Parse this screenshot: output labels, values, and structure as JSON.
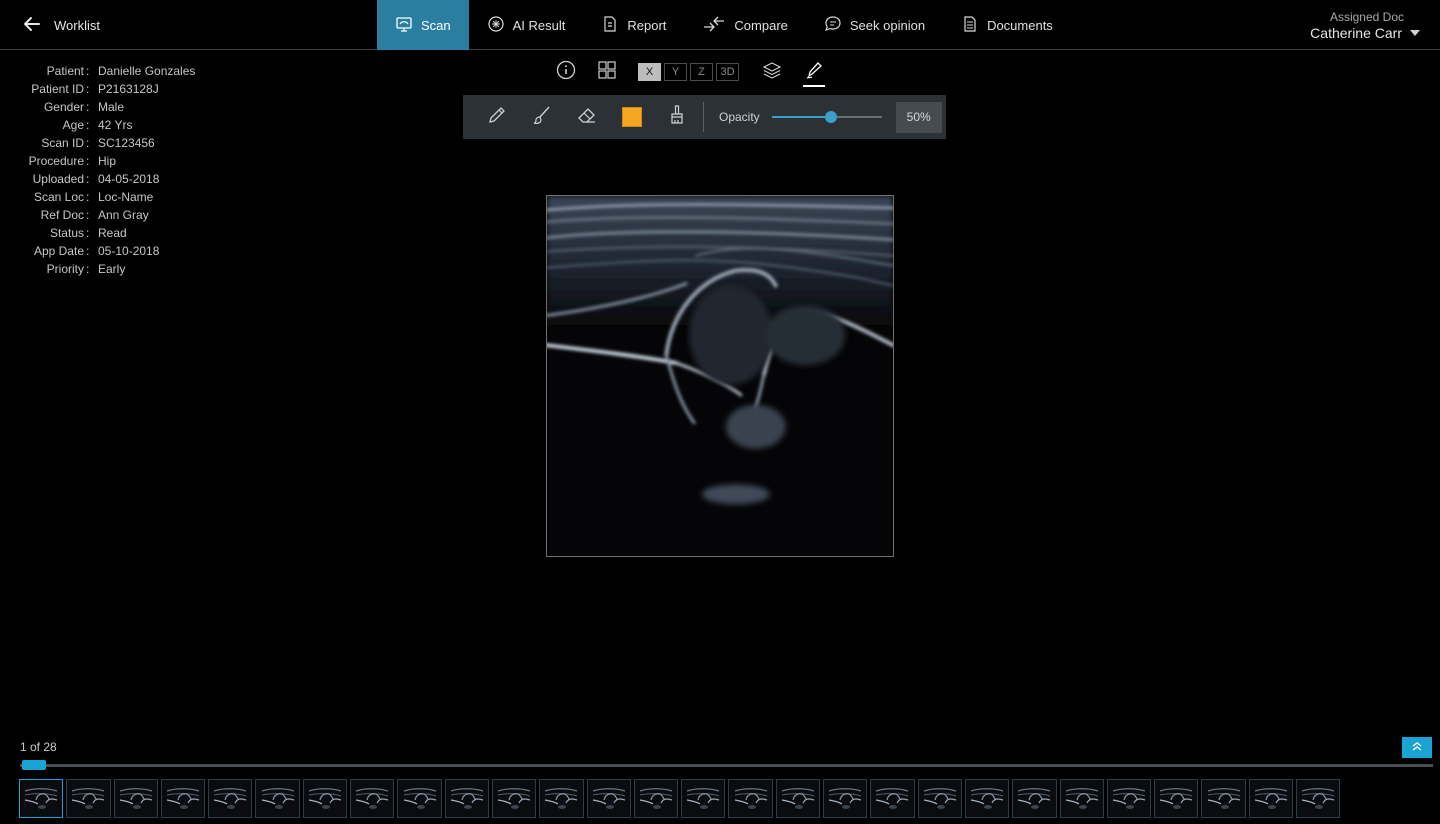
{
  "nav": {
    "back_label": "Worklist",
    "tabs": [
      {
        "label": "Scan",
        "icon": "scan-icon",
        "active": true
      },
      {
        "label": "AI Result",
        "icon": "ai-brain-icon",
        "active": false
      },
      {
        "label": "Report",
        "icon": "report-icon",
        "active": false
      },
      {
        "label": "Compare",
        "icon": "compare-icon",
        "active": false
      },
      {
        "label": "Seek opinion",
        "icon": "chat-bubble-icon",
        "active": false
      },
      {
        "label": "Documents",
        "icon": "document-icon",
        "active": false
      }
    ],
    "assigned_label": "Assigned Doc",
    "assigned_doc": "Catherine Carr"
  },
  "patient": [
    {
      "key": "Patient",
      "value": "Danielle Gonzales"
    },
    {
      "key": "Patient ID",
      "value": "P2163128J"
    },
    {
      "key": "Gender",
      "value": "Male"
    },
    {
      "key": "Age",
      "value": "42 Yrs"
    },
    {
      "key": "Scan ID",
      "value": "SC123456"
    },
    {
      "key": "Procedure",
      "value": "Hip"
    },
    {
      "key": "Uploaded",
      "value": "04-05-2018"
    },
    {
      "key": "Scan Loc",
      "value": "Loc-Name"
    },
    {
      "key": "Ref Doc",
      "value": "Ann Gray"
    },
    {
      "key": "Status",
      "value": "Read"
    },
    {
      "key": "App Date",
      "value": "05-10-2018"
    },
    {
      "key": "Priority",
      "value": "Early"
    }
  ],
  "viewer": {
    "axes": [
      "X",
      "Y",
      "Z",
      "3D"
    ],
    "selected_axis": "X"
  },
  "toolbar": {
    "tools": [
      "pencil-icon",
      "brush-icon",
      "eraser-icon",
      "color-swatch",
      "fill-brush-icon"
    ],
    "color": "#f5a623",
    "opacity_label": "Opacity",
    "opacity_percent": 54,
    "opacity_value": "50%"
  },
  "footer": {
    "counter": "1 of 28",
    "current_frame": 1,
    "total_frames": 28,
    "accent": "#1ca3d6"
  }
}
